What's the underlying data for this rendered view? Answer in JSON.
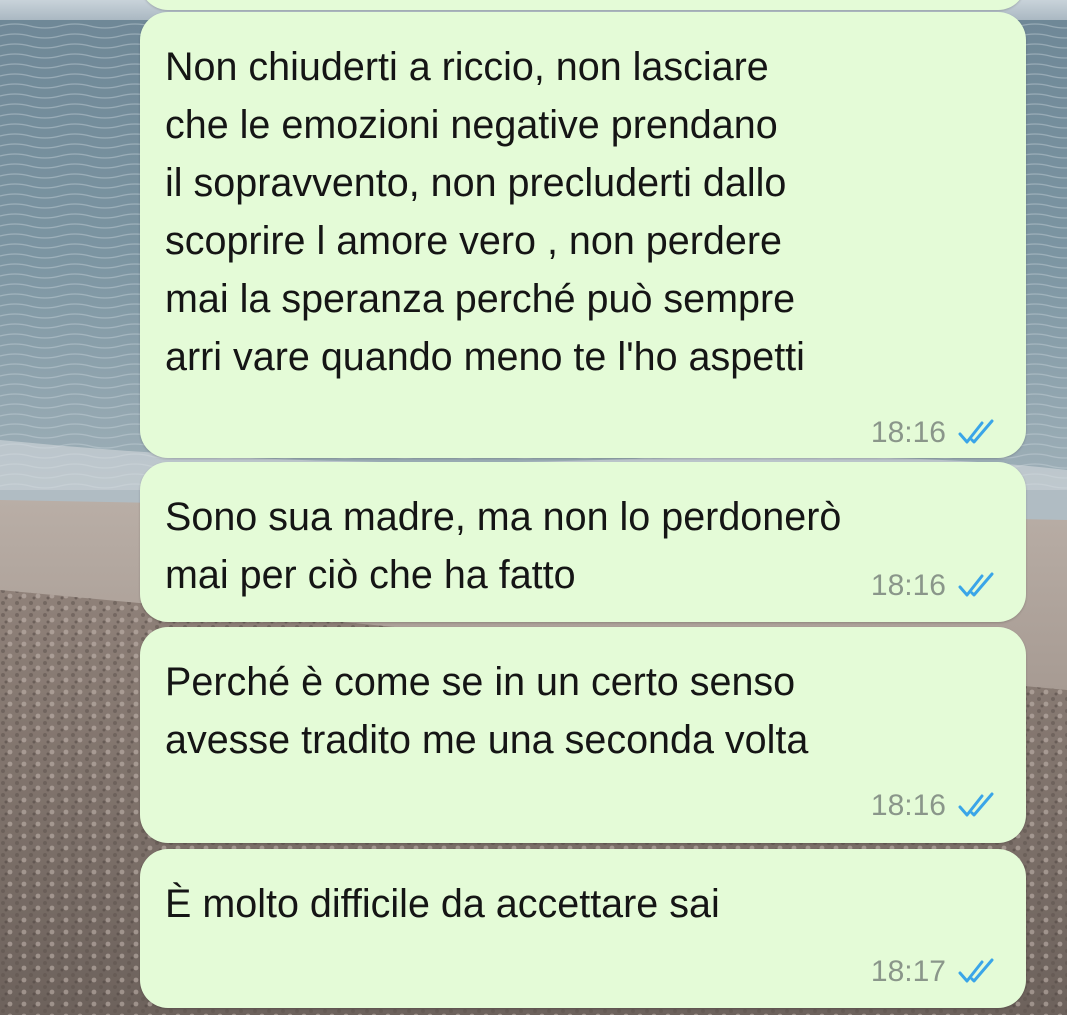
{
  "chat": {
    "messages": [
      {
        "text": "Non chiuderti a riccio, non lasciare\nche le emozioni negative prendano\nil sopravvento, non precluderti dallo\nscoprire l amore vero , non perdere\nmai la speranza perché può sempre\narri vare quando meno te l'ho aspetti",
        "time": "18:16",
        "status": "read"
      },
      {
        "text": "Sono sua madre, ma non lo perdonerò\nmai per ciò che ha fatto",
        "time": "18:16",
        "status": "read"
      },
      {
        "text": "Perché è come se in un certo senso\navesse tradito me una seconda volta",
        "time": "18:16",
        "status": "read"
      },
      {
        "text": "È molto difficile da accettare sai",
        "time": "18:17",
        "status": "read"
      }
    ]
  },
  "colors": {
    "outgoing_bubble": "#e4fbd7",
    "read_ticks": "#3aa5e8",
    "timestamp": "#8a968a"
  },
  "icons": {
    "read_receipt": "double-check-icon"
  },
  "wallpaper": "beach-sea-photo"
}
